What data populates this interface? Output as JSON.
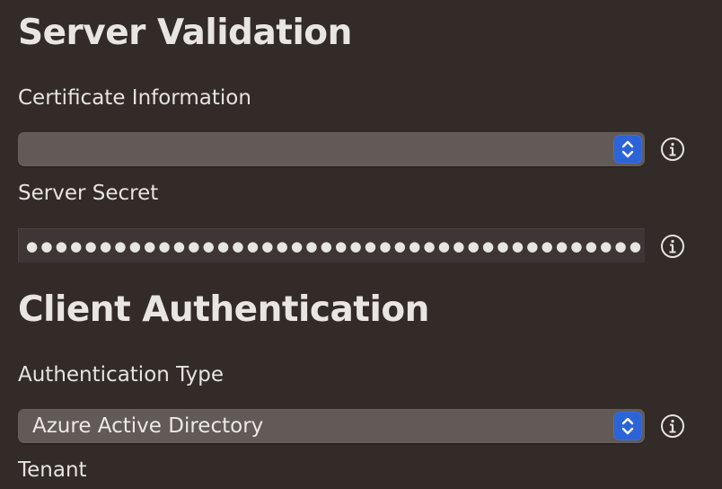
{
  "server_validation": {
    "title": "Server Validation",
    "certificate_label": "Certificate Information",
    "certificate_value": "",
    "secret_label": "Server Secret",
    "secret_masked": "●●●●●●●●●●●●●●●●●●●●●●●●●●●●●●●●●●●●●●●●●●●●●●●●●●●●●●●●●●●●"
  },
  "client_authentication": {
    "title": "Client Authentication",
    "auth_type_label": "Authentication Type",
    "auth_type_value": "Azure Active Directory",
    "tenant_label": "Tenant"
  },
  "icons": {
    "info": "info-circle-icon",
    "stepper": "chevron-up-down-icon"
  },
  "colors": {
    "background": "#322b28",
    "popup": "#615a57",
    "accent": "#2c63d6"
  }
}
